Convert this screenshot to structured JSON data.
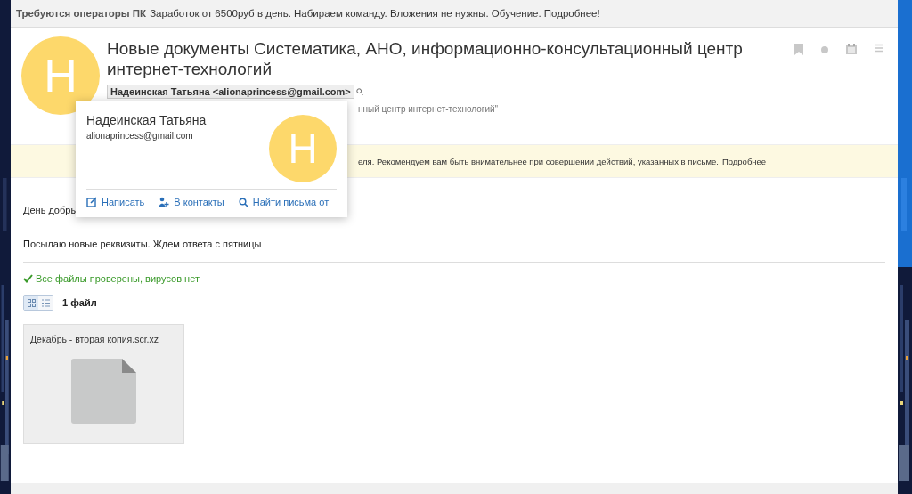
{
  "banner": {
    "bold": "Требуются операторы ПК",
    "text": "Заработок от 6500руб в день. Набираем команду. Вложения не нужны. Обучение. Подробнее!"
  },
  "message": {
    "avatar_letter": "Н",
    "subject": "Новые документы Систематика, АНО, информационно-консультационный центр интернет-технологий",
    "sender": "Надеинская Татьяна <alionaprincess@gmail.com>",
    "recipient_tail": "нный центр интернет-технологий\"",
    "warning": "еля. Рекомендуем вам быть внимательнее при совершении действий, указанных в письме.",
    "warning_link": "Подробнее",
    "greeting": "День добры",
    "body": "Посылаю новые реквизиты. Ждем ответа с пятницы",
    "scan_status": "Все файлы проверены, вирусов нет",
    "view_modes": [
      {
        "kind": "grid",
        "selected": true
      },
      {
        "kind": "list",
        "selected": false
      }
    ],
    "file_count": "1 файл",
    "attachments": [
      {
        "name": "Декабрь - вторая копия.scr.xz"
      }
    ]
  },
  "popup": {
    "name": "Надеинская Татьяна",
    "email": "alionaprincess@gmail.com",
    "avatar_letter": "Н",
    "actions": [
      {
        "kind": "write",
        "label": "Написать"
      },
      {
        "kind": "contact",
        "label": "В контакты"
      },
      {
        "kind": "search",
        "label": "Найти письма от"
      }
    ]
  }
}
